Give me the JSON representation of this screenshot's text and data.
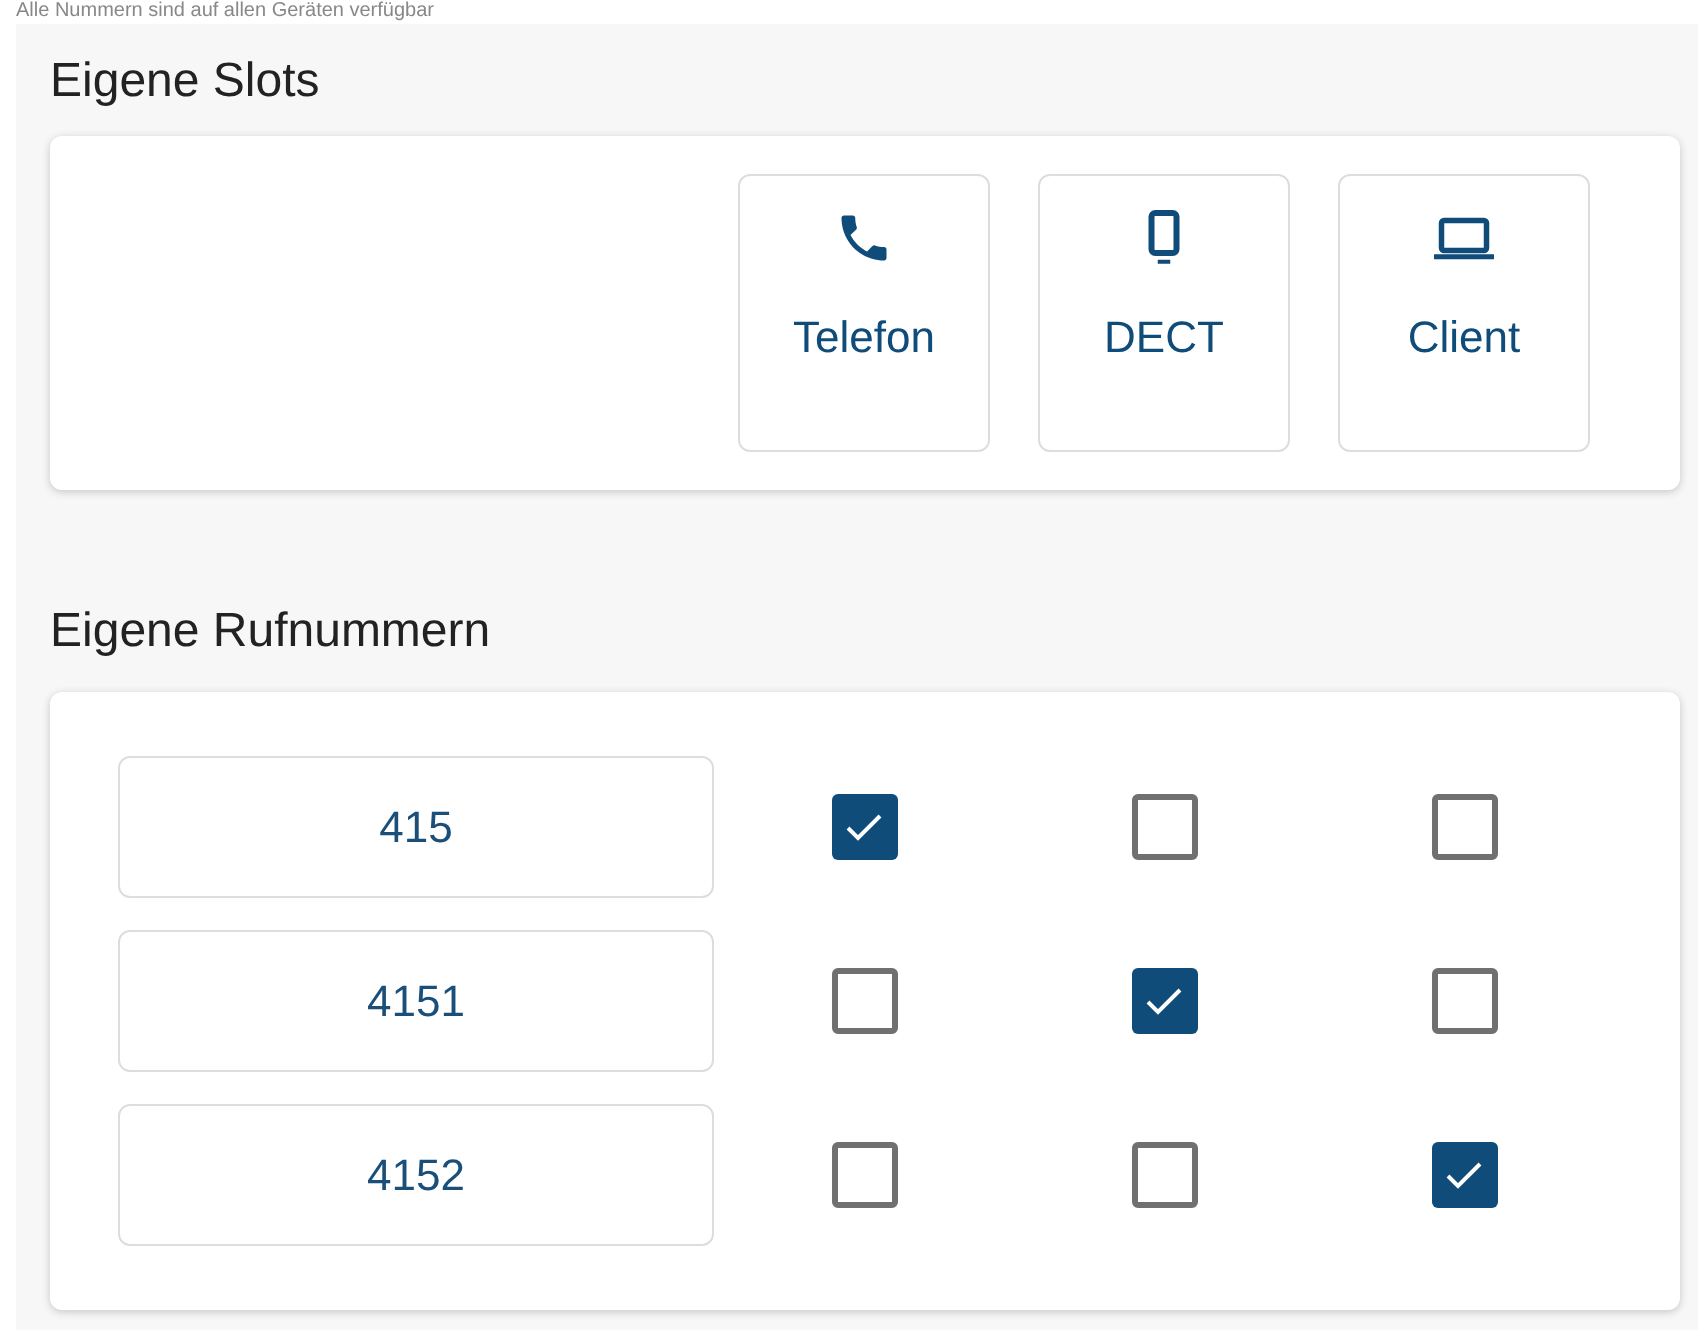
{
  "notice": "Alle Nummern sind auf allen Geräten verfügbar",
  "slots": {
    "title": "Eigene Slots",
    "devices": [
      {
        "kind": "phone",
        "label": "Telefon"
      },
      {
        "kind": "dect",
        "label": "DECT"
      },
      {
        "kind": "client",
        "label": "Client"
      }
    ]
  },
  "numbers": {
    "title": "Eigene Rufnummern",
    "rows": [
      {
        "number": "415",
        "assigned": [
          true,
          false,
          false
        ]
      },
      {
        "number": "4151",
        "assigned": [
          false,
          true,
          false
        ]
      },
      {
        "number": "4152",
        "assigned": [
          false,
          false,
          true
        ]
      }
    ]
  }
}
